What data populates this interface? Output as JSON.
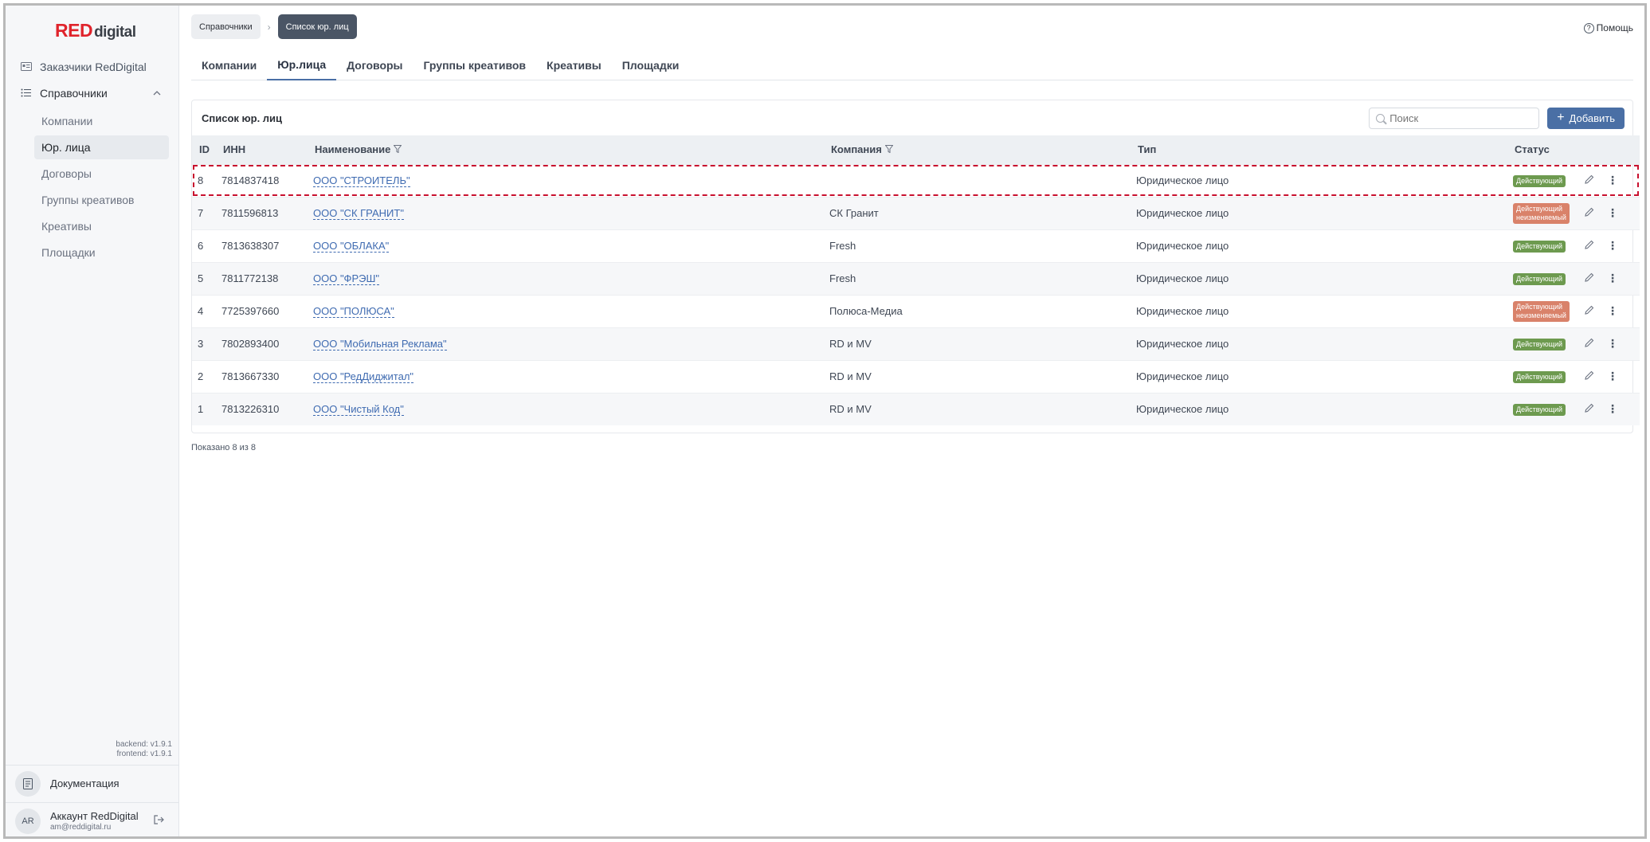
{
  "brand": {
    "logo_red": "RED",
    "logo_text": "digital",
    "accent": "#e0242c"
  },
  "sidebar": {
    "top_item": {
      "label": "Заказчики RedDigital",
      "icon": "id-card-icon"
    },
    "group": {
      "label": "Справочники",
      "icon": "list-icon"
    },
    "items": [
      {
        "label": "Компании"
      },
      {
        "label": "Юр. лица",
        "active": true
      },
      {
        "label": "Договоры"
      },
      {
        "label": "Группы креативов"
      },
      {
        "label": "Креативы"
      },
      {
        "label": "Площадки"
      }
    ],
    "versions": {
      "backend": "backend: v1.9.1",
      "frontend": "frontend: v1.9.1"
    },
    "docs_label": "Документация",
    "account": {
      "initials": "AR",
      "name": "Аккаунт RedDigital",
      "email": "am@reddigital.ru"
    }
  },
  "breadcrumb": {
    "first": "Справочники",
    "current": "Список юр. лиц"
  },
  "help_label": "Помощь",
  "tabs": [
    {
      "label": "Компании"
    },
    {
      "label": "Юр.лица",
      "active": true
    },
    {
      "label": "Договоры"
    },
    {
      "label": "Группы креативов"
    },
    {
      "label": "Креативы"
    },
    {
      "label": "Площадки"
    }
  ],
  "panel": {
    "title": "Список юр. лиц",
    "search_placeholder": "Поиск",
    "add_label": "Добавить"
  },
  "table": {
    "headers": {
      "id": "ID",
      "inn": "ИНН",
      "name": "Наименование",
      "company": "Компания",
      "type": "Тип",
      "status": "Статус"
    },
    "rows": [
      {
        "id": "8",
        "inn": "7814837418",
        "name": "ООО \"СТРОИТЕЛЬ\"",
        "company": "",
        "type": "Юридическое лицо",
        "status": [
          "Действующий"
        ],
        "status_color": "green",
        "highlight": true
      },
      {
        "id": "7",
        "inn": "7811596813",
        "name": "ООО \"СК ГРАНИТ\"",
        "company": "СК Гранит",
        "type": "Юридическое лицо",
        "status": [
          "Действующий",
          "неизменяемый"
        ],
        "status_color": "red"
      },
      {
        "id": "6",
        "inn": "7813638307",
        "name": "ООО \"ОБЛАКА\"",
        "company": "Fresh",
        "type": "Юридическое лицо",
        "status": [
          "Действующий"
        ],
        "status_color": "green"
      },
      {
        "id": "5",
        "inn": "7811772138",
        "name": "ООО \"ФРЭШ\"",
        "company": "Fresh",
        "type": "Юридическое лицо",
        "status": [
          "Действующий"
        ],
        "status_color": "green"
      },
      {
        "id": "4",
        "inn": "7725397660",
        "name": "ООО \"ПОЛЮСА\"",
        "company": "Полюса-Медиа",
        "type": "Юридическое лицо",
        "status": [
          "Действующий",
          "неизменяемый"
        ],
        "status_color": "red"
      },
      {
        "id": "3",
        "inn": "7802893400",
        "name": "ООО \"Мобильная Реклама\"",
        "company": "RD и MV",
        "type": "Юридическое лицо",
        "status": [
          "Действующий"
        ],
        "status_color": "green"
      },
      {
        "id": "2",
        "inn": "7813667330",
        "name": "ООО \"РедДиджитал\"",
        "company": "RD и MV",
        "type": "Юридическое лицо",
        "status": [
          "Действующий"
        ],
        "status_color": "green"
      },
      {
        "id": "1",
        "inn": "7813226310",
        "name": "ООО \"Чистый Код\"",
        "company": "RD и MV",
        "type": "Юридическое лицо",
        "status": [
          "Действующий"
        ],
        "status_color": "green"
      }
    ]
  },
  "shown_text": "Показано 8 из 8",
  "colors": {
    "primary": "#4a6fa5",
    "status_green": "#6d9a4f",
    "status_red": "#d9826a",
    "highlight_dashed": "#c8102e"
  }
}
